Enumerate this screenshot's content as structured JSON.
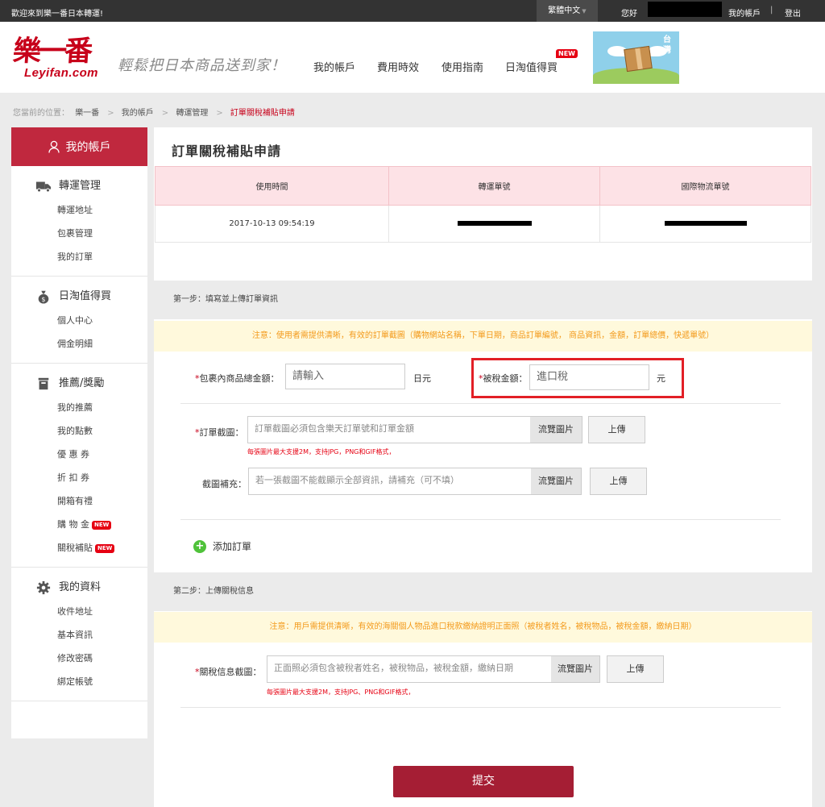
{
  "topbar": {
    "welcome": "歡迎來到樂一番日本轉運!",
    "language": "繁體中文",
    "hello": "您好",
    "my_account": "我的帳戶",
    "separator": "|",
    "logout": "登出"
  },
  "header": {
    "logo_cn": "樂一番",
    "logo_en": "Leyifan.com",
    "slogan": "輕鬆把日本商品送到家！",
    "nav": [
      "我的帳戶",
      "費用時效",
      "使用指南",
      "日淘值得買"
    ],
    "new_badge": "NEW",
    "banner_text": "台灣"
  },
  "breadcrumb": {
    "label": "您當前的位置：",
    "items": [
      "樂一番",
      "我的帳戶",
      "轉運管理",
      "訂單關稅補貼申請"
    ]
  },
  "sidebar": {
    "header": "我的帳戶",
    "groups": [
      {
        "title": "轉運管理",
        "icon": "truck-icon",
        "links": [
          "轉運地址",
          "包裹管理",
          "我的訂單"
        ]
      },
      {
        "title": "日淘值得買",
        "icon": "money-bag-icon",
        "links": [
          "個人中心",
          "佣金明細"
        ]
      },
      {
        "title": "推薦/獎勵",
        "icon": "trash-box-icon",
        "links": [
          "我的推薦",
          "我的點數",
          "優 惠 券",
          "折 扣 券",
          "開箱有禮",
          "購 物 金",
          "關稅補貼"
        ]
      },
      {
        "title": "我的資料",
        "icon": "gear-icon",
        "links": [
          "收件地址",
          "基本資訊",
          "修改密碼",
          "綁定帳號"
        ]
      }
    ],
    "new_badge": "NEW"
  },
  "main": {
    "title": "訂單關稅補貼申請",
    "table": {
      "headers": [
        "使用時間",
        "轉運單號",
        "國際物流單號"
      ],
      "row": [
        "2017-10-13 09:54:19",
        "",
        ""
      ]
    },
    "step1": {
      "title": "第一步：填寫並上傳訂單資訊",
      "notice": "注意：使用者需提供清晰，有效的訂單截圖（購物網站名稱，下單日期，商品訂單編號， 商品資訊，金額，訂單總價，快遞單號）",
      "total_label": "包裹內商品總金額：",
      "total_placeholder": "請輸入",
      "total_unit": "日元",
      "tax_label": "被稅金額：",
      "tax_placeholder": "進口稅",
      "tax_unit": "元",
      "screenshot_label": "訂單截圖：",
      "screenshot_placeholder": "訂單截圖必須包含樂天訂單號和訂單金額",
      "browse": "流覽圖片",
      "upload": "上傳",
      "hint": "每張圖片最大支援2M，支持JPG，PNG和GIF格式，",
      "supplement_label": "截圖補充：",
      "supplement_placeholder": "若一張截圖不能截顯示全部資訊，請補充（可不填）",
      "add_order": "添加訂單"
    },
    "step2": {
      "title": "第二步：上傳關稅信息",
      "notice": "注意：用戶需提供清晰，有效的海關個人物品進口稅款繳納證明正面照（被稅者姓名，被稅物品，被稅金額，繳納日期）",
      "tax_info_label": "關稅信息截圖：",
      "tax_info_placeholder": "正面照必須包含被稅者姓名，被稅物品，被稅金額，繳納日期",
      "browse": "流覽圖片",
      "upload": "上傳",
      "hint": "每張圖片最大支援2M，支持JPG、PNG和GIF格式，"
    },
    "submit": "提交"
  }
}
